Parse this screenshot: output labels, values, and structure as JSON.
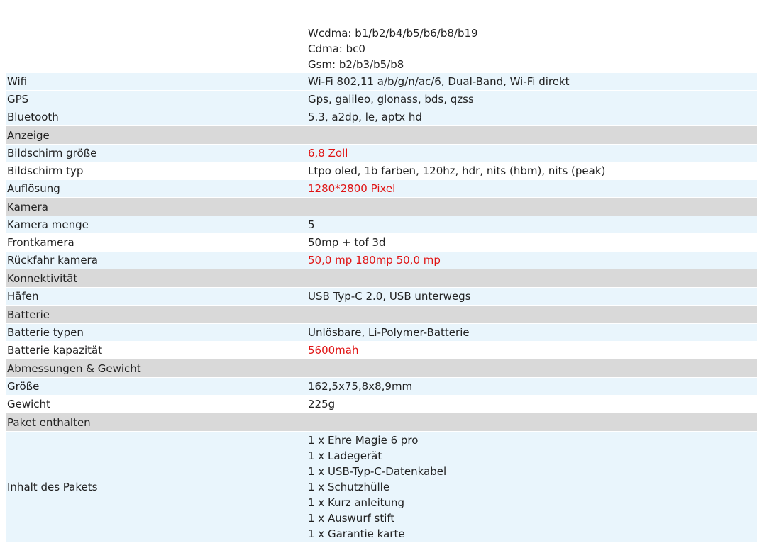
{
  "top_values": [
    "Wcdma: b1/b2/b4/b5/b6/b8/b19",
    "Cdma: bc0",
    "Gsm: b2/b3/b5/b8"
  ],
  "rows": {
    "wifi": {
      "label": "Wifi",
      "value": "Wi-Fi 802,11 a/b/g/n/ac/6, Dual-Band, Wi-Fi direkt"
    },
    "gps": {
      "label": "GPS",
      "value": "Gps, galileo, glonass, bds, qzss"
    },
    "bluetooth": {
      "label": "Bluetooth",
      "value": "5.3, a2dp, le, aptx hd"
    },
    "section_anzeige": {
      "label": "Anzeige"
    },
    "bildschirm_groesse": {
      "label": "Bildschirm größe",
      "value": "6,8 Zoll"
    },
    "bildschirm_typ": {
      "label": "Bildschirm typ",
      "value": "Ltpo oled, 1b farben, 120hz, hdr, nits (hbm), nits (peak)"
    },
    "aufloesung": {
      "label": "Auflösung",
      "value": "1280*2800 Pixel"
    },
    "section_kamera": {
      "label": "Kamera"
    },
    "kamera_menge": {
      "label": "Kamera menge",
      "value": "5"
    },
    "frontkamera": {
      "label": "Frontkamera",
      "value": "50mp + tof 3d"
    },
    "rueckfahr_kamera": {
      "label": "Rückfahr kamera",
      "value": "50,0 mp 180mp 50,0 mp"
    },
    "section_konnektivitaet": {
      "label": "Konnektivität"
    },
    "haefen": {
      "label": "Häfen",
      "value": "USB Typ-C 2.0, USB unterwegs"
    },
    "section_batterie": {
      "label": "Batterie"
    },
    "batterie_typen": {
      "label": "Batterie typen",
      "value": "Unlösbare, Li-Polymer-Batterie"
    },
    "batterie_kapazitaet": {
      "label": "Batterie kapazität",
      "value": "5600mah"
    },
    "section_abmessungen": {
      "label": "Abmessungen & Gewicht"
    },
    "groesse": {
      "label": "Größe",
      "value": "162,5x75,8x8,9mm"
    },
    "gewicht": {
      "label": "Gewicht",
      "value": "225g"
    },
    "section_paket": {
      "label": "Paket enthalten"
    },
    "inhalt": {
      "label": "Inhalt des Pakets",
      "values": [
        "1 x Ehre Magie 6 pro",
        "1 x Ladegerät",
        "1 x USB-Typ-C-Datenkabel",
        "1 x Schutzhülle",
        "1 x Kurz anleitung",
        "1 x Auswurf stift",
        "1 x Garantie karte"
      ]
    }
  },
  "colors": {
    "highlight": "#e01414",
    "row_tint": "#e9f5fc",
    "section_bg": "#d9d9d9"
  }
}
